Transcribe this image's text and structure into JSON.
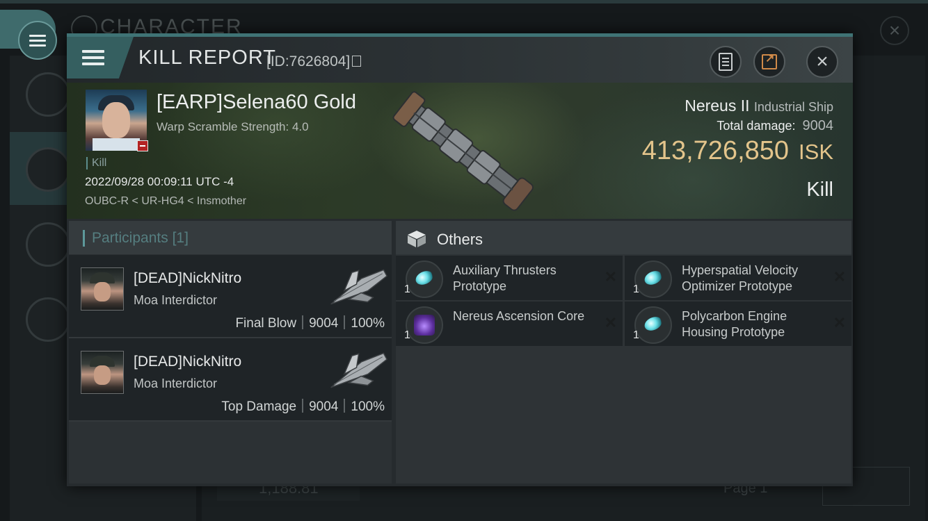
{
  "background": {
    "title": "CHARACTER",
    "balance": "1,188.81",
    "page": "Page 1"
  },
  "header": {
    "title": "KILL REPORT",
    "id_text": "[ID:7626804]"
  },
  "victim": {
    "name": "[EARP]Selena60 Gold",
    "warp_scramble": "Warp Scramble Strength: 4.0",
    "kill_tag": "Kill",
    "datetime": "2022/09/28 00:09:11 UTC -4",
    "location": "OUBC-R < UR-HG4 < Insmother"
  },
  "ship": {
    "name": "Nereus II",
    "class": "Industrial Ship",
    "total_damage_label": "Total damage:",
    "total_damage": "9004",
    "isk_value": "413,726,850",
    "isk_unit": "ISK",
    "result": "Kill"
  },
  "participants": {
    "title": "Participants",
    "count": "[1]",
    "items": [
      {
        "name": "[DEAD]NickNitro",
        "ship": "Moa Interdictor",
        "role": "Final Blow",
        "damage": "9004",
        "percent": "100%"
      },
      {
        "name": "[DEAD]NickNitro",
        "ship": "Moa Interdictor",
        "role": "Top Damage",
        "damage": "9004",
        "percent": "100%"
      }
    ]
  },
  "others": {
    "title": "Others",
    "items": [
      {
        "qty": "1",
        "name": "Auxiliary Thrusters Prototype",
        "icon": "thruster-module-icon"
      },
      {
        "qty": "1",
        "name": "Hyperspatial Velocity Optimizer Prototype",
        "icon": "thruster-module-icon"
      },
      {
        "qty": "1",
        "name": "Nereus Ascension Core",
        "icon": "ascension-core-icon"
      },
      {
        "qty": "1",
        "name": "Polycarbon Engine Housing Prototype",
        "icon": "thruster-module-icon"
      }
    ]
  },
  "colors": {
    "accent": "#3f7375",
    "isk": "#e3c48b",
    "participants_title": "#557e80"
  }
}
